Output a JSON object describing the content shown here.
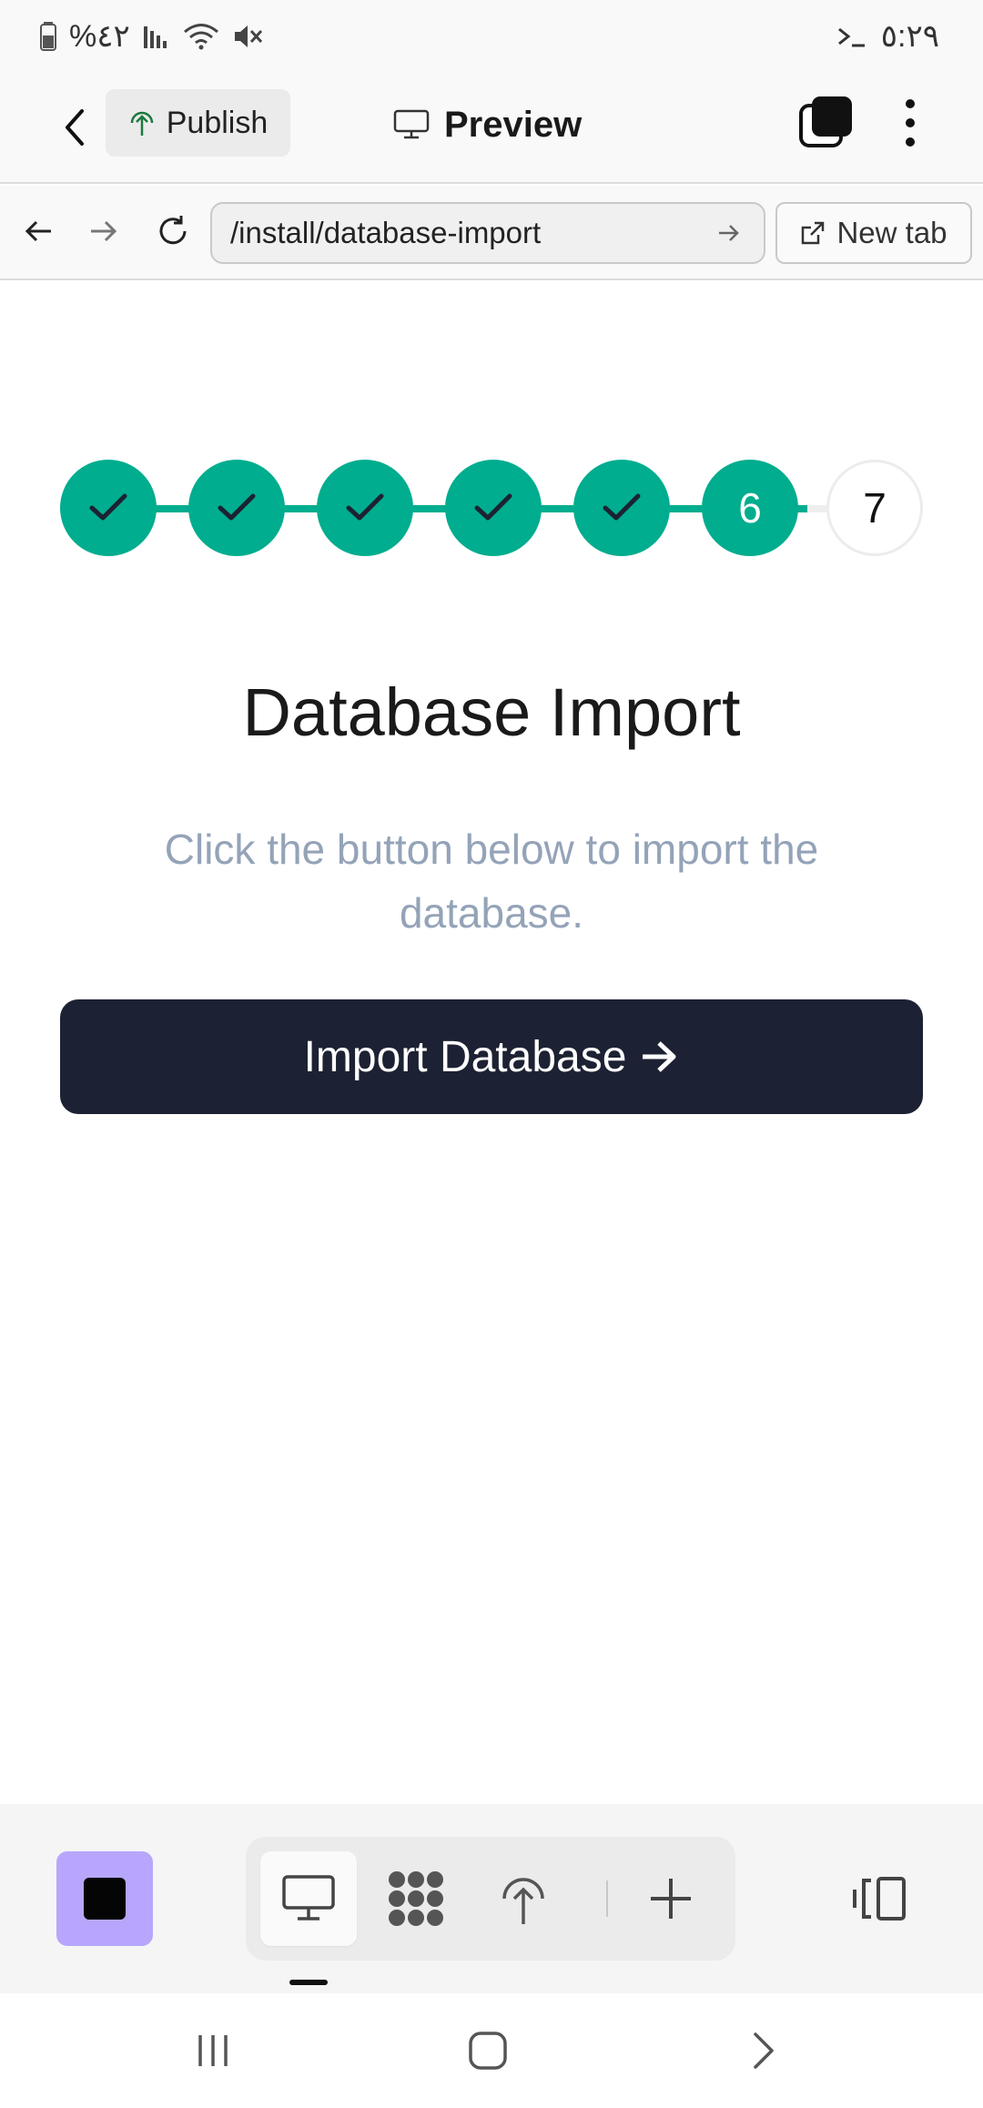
{
  "status_bar": {
    "battery": "%٤٢",
    "time": "٥:٢٩"
  },
  "header": {
    "publish_label": "Publish",
    "preview_label": "Preview"
  },
  "browser": {
    "url": "/install/database-import",
    "new_tab_label": "New tab"
  },
  "stepper": {
    "steps": [
      {
        "status": "completed",
        "label": ""
      },
      {
        "status": "completed",
        "label": ""
      },
      {
        "status": "completed",
        "label": ""
      },
      {
        "status": "completed",
        "label": ""
      },
      {
        "status": "completed",
        "label": ""
      },
      {
        "status": "current",
        "label": "6"
      },
      {
        "status": "pending",
        "label": "7"
      }
    ]
  },
  "main": {
    "title": "Database Import",
    "description": "Click the button below to import the database.",
    "import_button_label": "Import Database"
  },
  "colors": {
    "accent": "#00ad8e",
    "button_bg": "#1c2233",
    "stop_bg": "#b7a6fb",
    "muted_text": "#94a3b8"
  }
}
